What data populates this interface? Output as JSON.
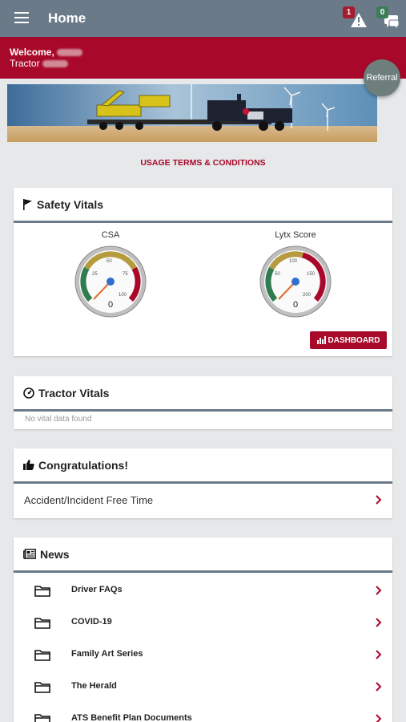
{
  "appbar": {
    "title": "Home",
    "alerts_count": "1",
    "messages_count": "0"
  },
  "welcome": {
    "line1": "Welcome,",
    "line2": "Tractor"
  },
  "referral_label": "Referral",
  "terms_label": "USAGE TERMS & CONDITIONS",
  "safety": {
    "title": "Safety Vitals",
    "gauges": [
      {
        "label": "CSA",
        "value": "0",
        "ticks": [
          "25",
          "50",
          "75",
          "100"
        ]
      },
      {
        "label": "Lytx Score",
        "value": "0",
        "ticks": [
          "50",
          "100",
          "150",
          "200"
        ]
      }
    ],
    "dashboard_label": "DASHBOARD"
  },
  "tractor": {
    "title": "Tractor Vitals",
    "empty_text": "No vital data found"
  },
  "congrats": {
    "title": "Congratulations!",
    "row_label": "Accident/Incident Free Time"
  },
  "news": {
    "title": "News",
    "items": [
      "Driver FAQs",
      "COVID-19",
      "Family Art Series",
      "The Herald",
      "ATS Benefit Plan Documents"
    ]
  },
  "colors": {
    "appbar": "#6b7a89",
    "brand_red": "#a8092a",
    "background": "#e6e8ea"
  }
}
